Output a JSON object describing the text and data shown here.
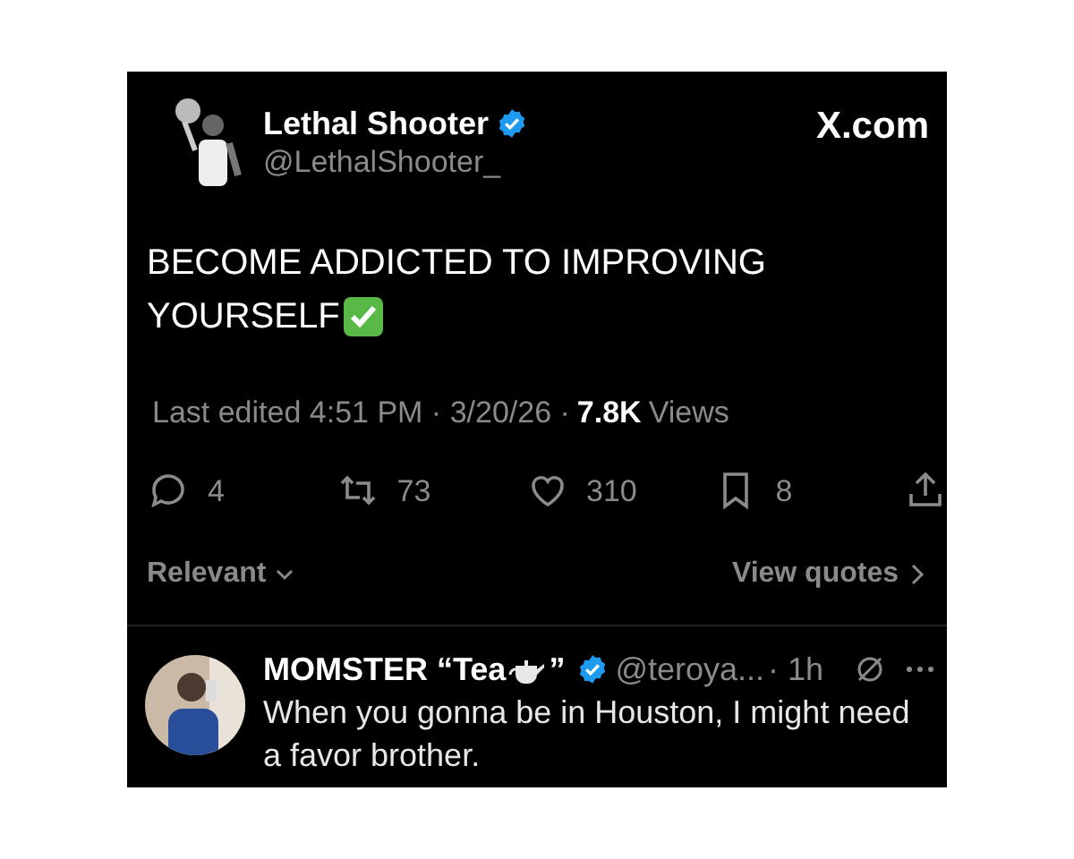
{
  "post": {
    "author": {
      "name": "Lethal Shooter",
      "handle": "@LethalShooter_",
      "verified": true
    },
    "brand": "X.com",
    "text_lines": [
      "BECOME ADDICTED TO IMPROVING",
      "YOURSELF"
    ],
    "meta": {
      "edited": "Last edited 4:51 PM · 3/20/26 ·",
      "views_count": "7.8K",
      "views_label": "Views"
    },
    "stats": [
      {
        "kind": "reply",
        "count": "4"
      },
      {
        "kind": "repost",
        "count": "73"
      },
      {
        "kind": "like",
        "count": "310"
      },
      {
        "kind": "bookmark",
        "count": "8"
      },
      {
        "kind": "share"
      }
    ]
  },
  "sort": {
    "label": "Relevant"
  },
  "quotes_link": "View quotes",
  "replies": [
    {
      "name_start": "MOMSTER “Tea",
      "name_end": "”",
      "verified": true,
      "handle": "@teroya...",
      "time": "· 1h",
      "text": "When you gonna be in Houston, I might need a favor brother."
    }
  ]
}
